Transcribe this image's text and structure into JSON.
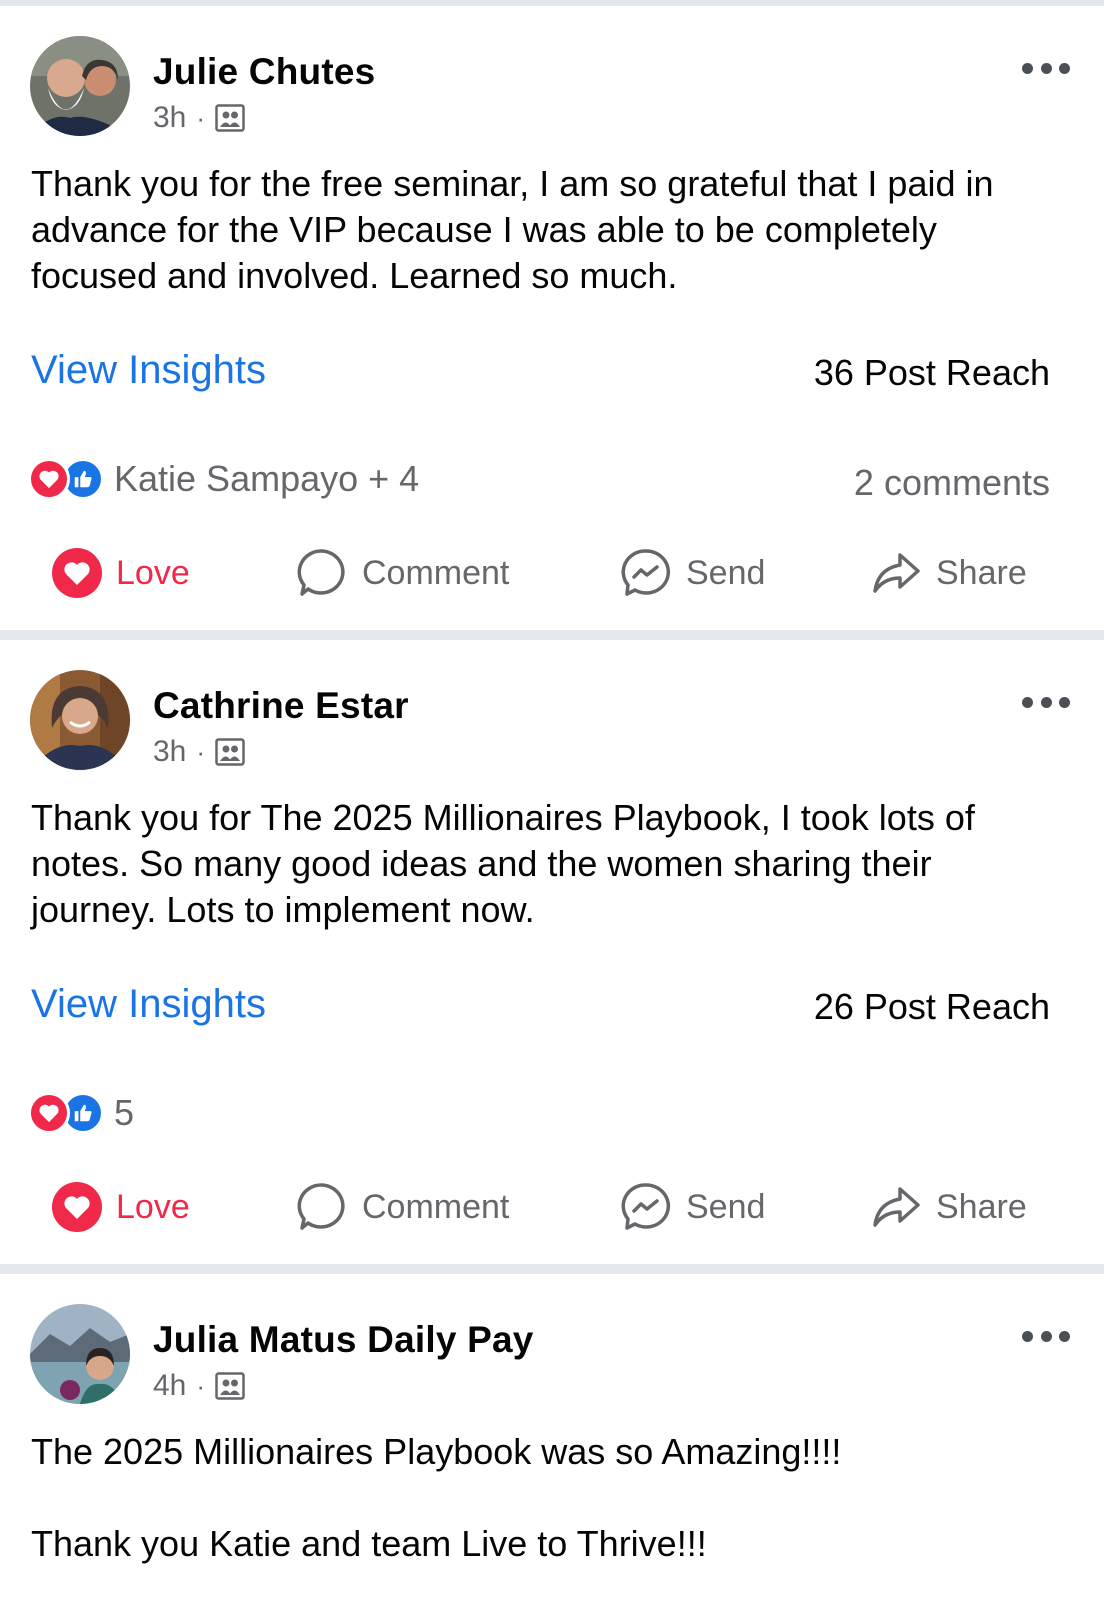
{
  "posts": [
    {
      "author": "Julie Chutes",
      "time": "3h",
      "separator": "·",
      "text": "Thank you for the free seminar, I am so grateful that I paid in advance for the VIP because I was able to be completely focused and involved. Learned so much.",
      "insights_label": "View Insights",
      "reach": "36 Post Reach",
      "reactions_text": "Katie Sampayo + 4",
      "comments": "2 comments",
      "actions": {
        "love": "Love",
        "comment": "Comment",
        "send": "Send",
        "share": "Share"
      }
    },
    {
      "author": "Cathrine Estar",
      "time": "3h",
      "separator": "·",
      "text": "Thank you for The 2025 Millionaires Playbook, I took lots of notes. So many good ideas and the women sharing their journey. Lots to implement now.",
      "insights_label": "View Insights",
      "reach": "26 Post Reach",
      "reactions_text": "5",
      "actions": {
        "love": "Love",
        "comment": "Comment",
        "send": "Send",
        "share": "Share"
      }
    },
    {
      "author": "Julia Matus Daily Pay",
      "time": "4h",
      "separator": "·",
      "text": "The 2025 Millionaires Playbook was so Amazing!!!!\n\nThank you Katie and team Live to Thrive!!!"
    }
  ],
  "colors": {
    "link": "#1b74e4",
    "love": "#f0284a",
    "muted": "#65676b",
    "divider": "#e4e7ec"
  },
  "icons": {
    "audience": "group-icon",
    "more": "more-options-icon",
    "love": "heart-icon",
    "like": "thumbs-up-icon",
    "comment": "speech-bubble-icon",
    "send": "messenger-icon",
    "share": "share-arrow-icon"
  }
}
